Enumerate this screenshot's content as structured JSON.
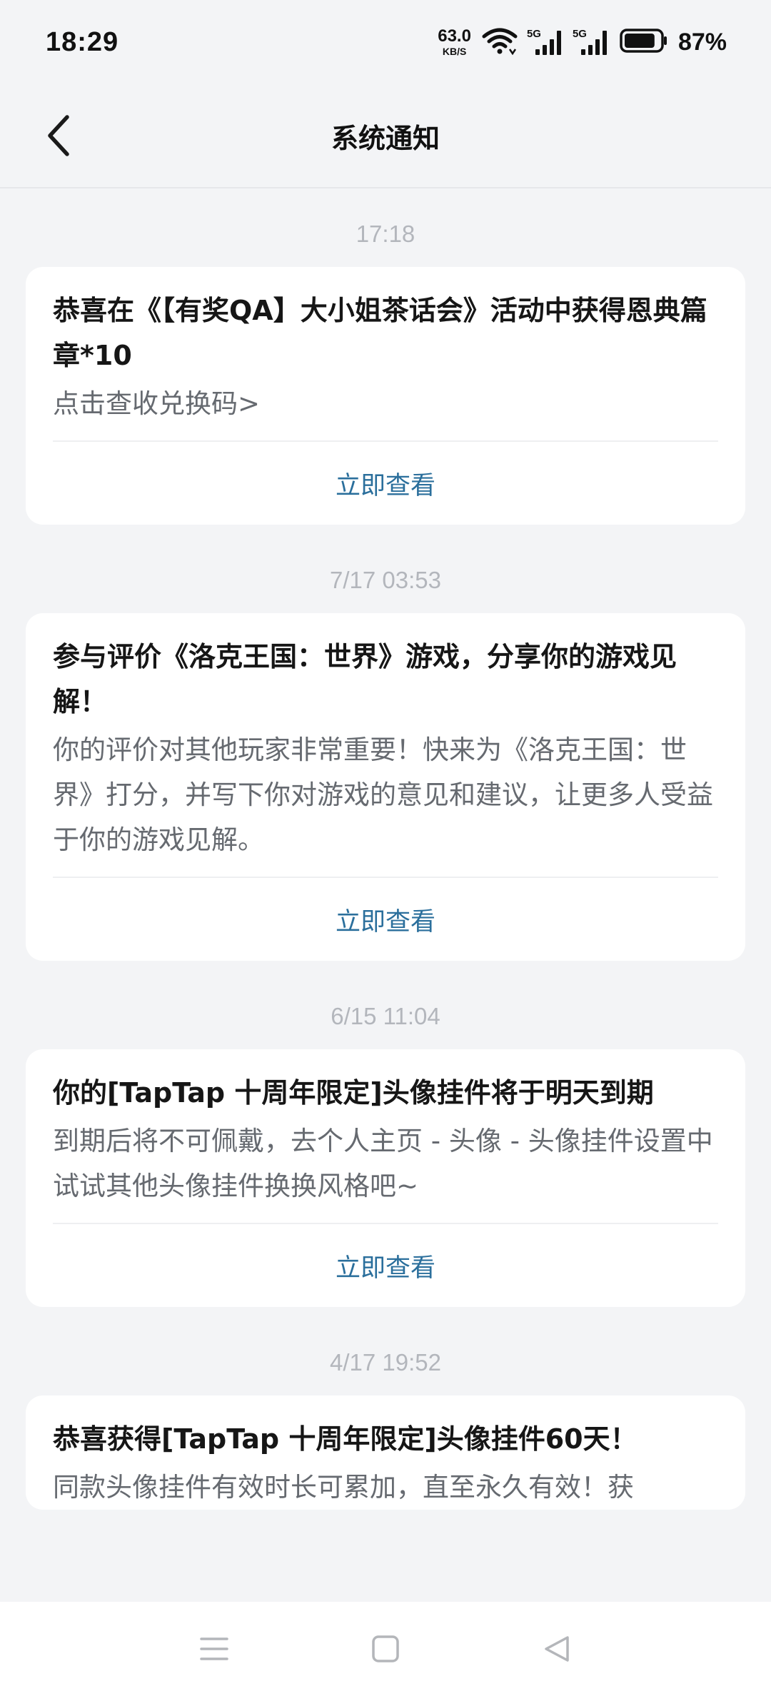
{
  "status_bar": {
    "time": "18:29",
    "net_speed_value": "63.0",
    "net_speed_unit": "KB/S",
    "signal_1_tag": "5G",
    "signal_2_tag": "5G",
    "battery_percent": "87%",
    "battery_level": 0.87,
    "icons": [
      "wifi-icon",
      "signal-icon",
      "signal-icon",
      "battery-icon"
    ]
  },
  "header": {
    "title": "系统通知",
    "back_icon": "back-chevron-icon"
  },
  "notifications": [
    {
      "time": "17:18",
      "title": "恭喜在《【有奖QA】大小姐茶话会》活动中获得恩典篇章*10",
      "body": "点击查收兑换码>",
      "action": "立即查看"
    },
    {
      "time": "7/17  03:53",
      "title": "参与评价《洛克王国：世界》游戏，分享你的游戏见解！",
      "body": "你的评价对其他玩家非常重要！快来为《洛克王国：世界》打分，并写下你对游戏的意见和建议，让更多人受益于你的游戏见解。",
      "action": "立即查看"
    },
    {
      "time": "6/15  11:04",
      "title": "你的[TapTap 十周年限定]头像挂件将于明天到期",
      "body": "到期后将不可佩戴，去个人主页 - 头像 - 头像挂件设置中试试其他头像挂件换换风格吧~",
      "action": "立即查看"
    },
    {
      "time": "4/17  19:52",
      "title": "恭喜获得[TapTap 十周年限定]头像挂件60天！",
      "body": "同款头像挂件有效时长可累加，直至永久有效！获",
      "action": ""
    }
  ],
  "nav_bar": {
    "icons": [
      "menu-icon",
      "home-square-icon",
      "back-triangle-icon"
    ]
  }
}
